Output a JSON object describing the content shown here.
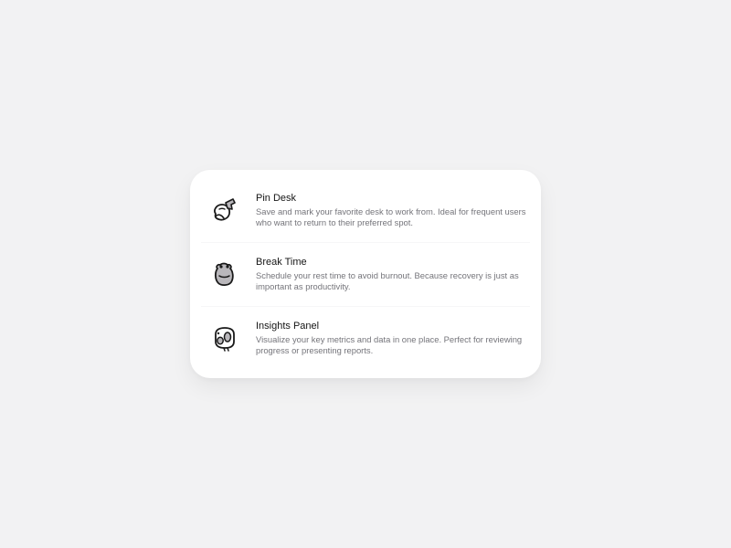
{
  "features": [
    {
      "icon": "pin-desk-icon",
      "title": "Pin Desk",
      "description": "Save and mark your favorite desk to work from. Ideal for frequent users who want to return to their preferred spot."
    },
    {
      "icon": "break-time-icon",
      "title": "Break Time",
      "description": "Schedule your rest time to avoid burnout. Because recovery is just as important as productivity."
    },
    {
      "icon": "insights-panel-icon",
      "title": "Insights Panel",
      "description": "Visualize your key metrics and data in one place. Perfect for reviewing progress or presenting reports."
    }
  ],
  "colors": {
    "background": "#f2f2f3",
    "card": "#ffffff",
    "title": "#151515",
    "description": "#74747a",
    "icon_stroke": "#1a1a1a",
    "icon_fill": "#b9b7bb"
  }
}
